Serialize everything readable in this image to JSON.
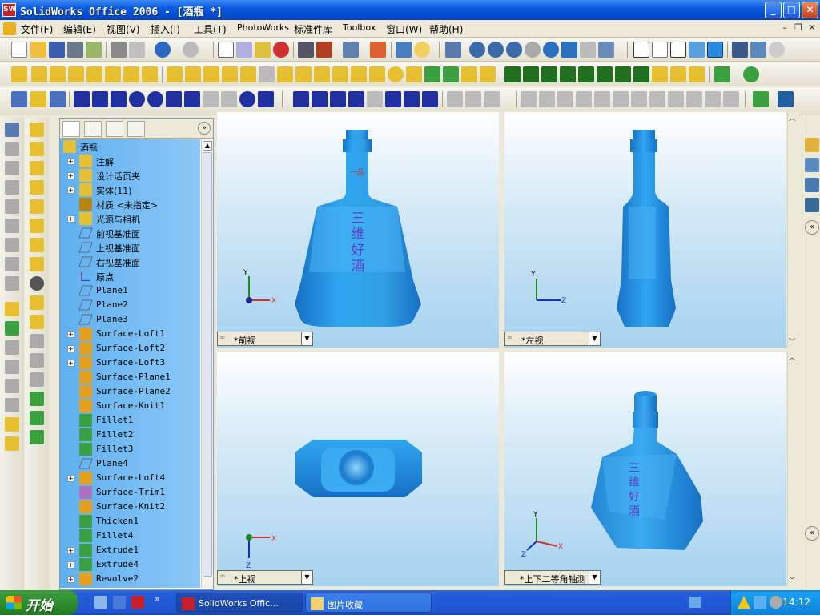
{
  "window": {
    "title": "SolidWorks Office 2006 - [酒瓶 *]",
    "app_icon": "SW",
    "buttons": {
      "min": "_",
      "max": "□",
      "close": "✕"
    }
  },
  "menu": {
    "items": [
      "文件(F)",
      "编辑(E)",
      "视图(V)",
      "插入(I)",
      "工具(T)",
      "PhotoWorks",
      "标准件库",
      "Toolbox",
      "窗口(W)",
      "帮助(H)"
    ],
    "mdi": {
      "min": "–",
      "restore": "❐",
      "close": "✕"
    }
  },
  "tree": {
    "root": "酒瓶",
    "items": [
      {
        "label": "注解",
        "exp": "+",
        "icon": "annotation-icon"
      },
      {
        "label": "设计活页夹",
        "exp": "+",
        "icon": "binder-icon"
      },
      {
        "label": "实体(11)",
        "exp": "+",
        "icon": "solid-bodies-icon"
      },
      {
        "label": "材质 <未指定>",
        "exp": "",
        "icon": "material-icon"
      },
      {
        "label": "光源与相机",
        "exp": "+",
        "icon": "lights-icon"
      },
      {
        "label": "前视基准面",
        "exp": "",
        "icon": "plane-icon"
      },
      {
        "label": "上视基准面",
        "exp": "",
        "icon": "plane-icon"
      },
      {
        "label": "右视基准面",
        "exp": "",
        "icon": "plane-icon"
      },
      {
        "label": "原点",
        "exp": "",
        "icon": "origin-icon"
      },
      {
        "label": "Plane1",
        "exp": "",
        "icon": "plane-icon"
      },
      {
        "label": "Plane2",
        "exp": "",
        "icon": "plane-icon"
      },
      {
        "label": "Plane3",
        "exp": "",
        "icon": "plane-icon"
      },
      {
        "label": "Surface-Loft1",
        "exp": "+",
        "icon": "surface-loft-icon"
      },
      {
        "label": "Surface-Loft2",
        "exp": "+",
        "icon": "surface-loft-icon"
      },
      {
        "label": "Surface-Loft3",
        "exp": "+",
        "icon": "surface-loft-icon"
      },
      {
        "label": "Surface-Plane1",
        "exp": "",
        "icon": "surface-plane-icon"
      },
      {
        "label": "Surface-Plane2",
        "exp": "",
        "icon": "surface-plane-icon"
      },
      {
        "label": "Surface-Knit1",
        "exp": "",
        "icon": "surface-knit-icon"
      },
      {
        "label": "Fillet1",
        "exp": "",
        "icon": "fillet-icon"
      },
      {
        "label": "Fillet2",
        "exp": "",
        "icon": "fillet-icon"
      },
      {
        "label": "Fillet3",
        "exp": "",
        "icon": "fillet-icon"
      },
      {
        "label": "Plane4",
        "exp": "",
        "icon": "plane-icon"
      },
      {
        "label": "Surface-Loft4",
        "exp": "+",
        "icon": "surface-loft-icon"
      },
      {
        "label": "Surface-Trim1",
        "exp": "",
        "icon": "surface-trim-icon"
      },
      {
        "label": "Surface-Knit2",
        "exp": "",
        "icon": "surface-knit-icon"
      },
      {
        "label": "Thicken1",
        "exp": "",
        "icon": "thicken-icon"
      },
      {
        "label": "Fillet4",
        "exp": "",
        "icon": "fillet-icon"
      },
      {
        "label": "Extrude1",
        "exp": "+",
        "icon": "extrude-icon"
      },
      {
        "label": "Extrude4",
        "exp": "+",
        "icon": "extrude-icon"
      },
      {
        "label": "Revolve2",
        "exp": "+",
        "icon": "revolve-icon"
      }
    ]
  },
  "views": {
    "front": {
      "label": "*前视",
      "axes": [
        "Y",
        "X"
      ]
    },
    "left": {
      "label": "*左视",
      "axes": [
        "Y",
        "Z"
      ]
    },
    "top": {
      "label": "*上视",
      "axes": [
        "X",
        "Z"
      ]
    },
    "iso": {
      "label": "*上下二等角轴测",
      "axes": [
        "Y",
        "X",
        "Z"
      ]
    }
  },
  "bottle": {
    "text": [
      "三",
      "维",
      "好",
      "酒"
    ],
    "neck_label": "一品",
    "body_color": "#2f9fe6",
    "dark_color": "#1670c4",
    "text_color": "#5b3fc4"
  },
  "taskbar": {
    "start": "开始",
    "tasks": [
      {
        "label": "SolidWorks Offic...",
        "icon": "solidworks-icon"
      },
      {
        "label": "图片收藏",
        "icon": "folder-icon"
      }
    ],
    "clock": "14:12"
  }
}
